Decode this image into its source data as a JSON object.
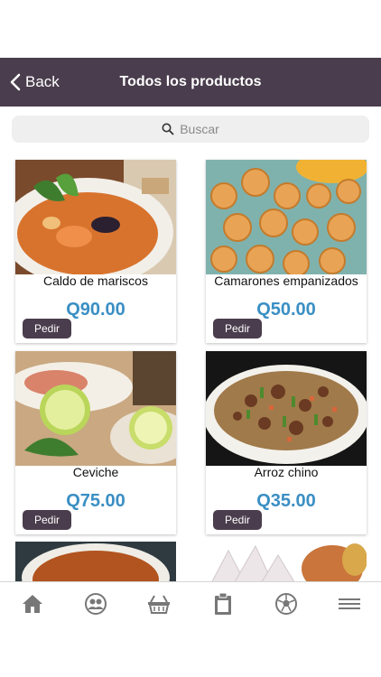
{
  "nav": {
    "back_label": "Back",
    "title": "Todos los productos"
  },
  "search": {
    "placeholder": "Buscar"
  },
  "products": [
    {
      "name": "Caldo de mariscos",
      "price": "Q90.00",
      "button": "Pedir"
    },
    {
      "name": "Camarones empanizados",
      "price": "Q50.00",
      "button": "Pedir"
    },
    {
      "name": "Ceviche",
      "price": "Q75.00",
      "button": "Pedir"
    },
    {
      "name": "Arroz chino",
      "price": "Q35.00",
      "button": "Pedir"
    }
  ],
  "tabbar": {
    "icons": [
      "home-icon",
      "users-icon",
      "basket-icon",
      "clipboard-icon",
      "soccer-ball-icon",
      "menu-icon"
    ]
  },
  "colors": {
    "primary": "#4a3d4d",
    "price": "#3a8fc4"
  }
}
